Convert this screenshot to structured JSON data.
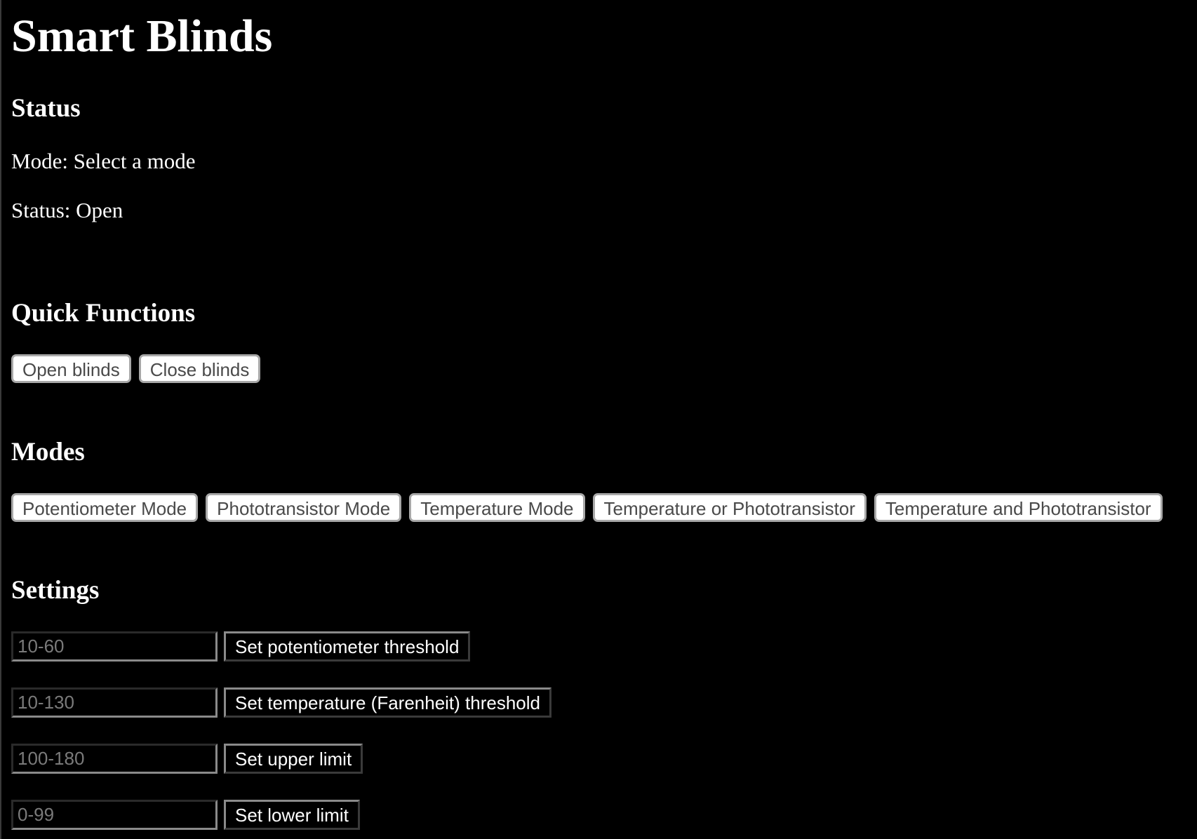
{
  "page": {
    "title": "Smart Blinds"
  },
  "status": {
    "heading": "Status",
    "mode_text": "Mode: Select a mode",
    "status_text": "Status: Open"
  },
  "quick_functions": {
    "heading": "Quick Functions",
    "open_label": "Open blinds",
    "close_label": "Close blinds"
  },
  "modes": {
    "heading": "Modes",
    "buttons": [
      {
        "label": "Potentiometer Mode"
      },
      {
        "label": "Phototransistor Mode"
      },
      {
        "label": "Temperature Mode"
      },
      {
        "label": "Temperature or Phototransistor"
      },
      {
        "label": "Temperature and Phototransistor"
      }
    ]
  },
  "settings": {
    "heading": "Settings",
    "rows": [
      {
        "placeholder": "10-60",
        "value": "",
        "button_label": "Set potentiometer threshold"
      },
      {
        "placeholder": "10-130",
        "value": "",
        "button_label": "Set temperature (Farenheit) threshold"
      },
      {
        "placeholder": "100-180",
        "value": "",
        "button_label": "Set upper limit"
      },
      {
        "placeholder": "0-99",
        "value": "",
        "button_label": "Set lower limit"
      }
    ]
  },
  "colors": {
    "background": "#000000",
    "text": "#ffffff",
    "light_button_bg": "#ffffff",
    "light_button_text": "#4a4a4a",
    "input_placeholder": "#7a7a7a"
  }
}
